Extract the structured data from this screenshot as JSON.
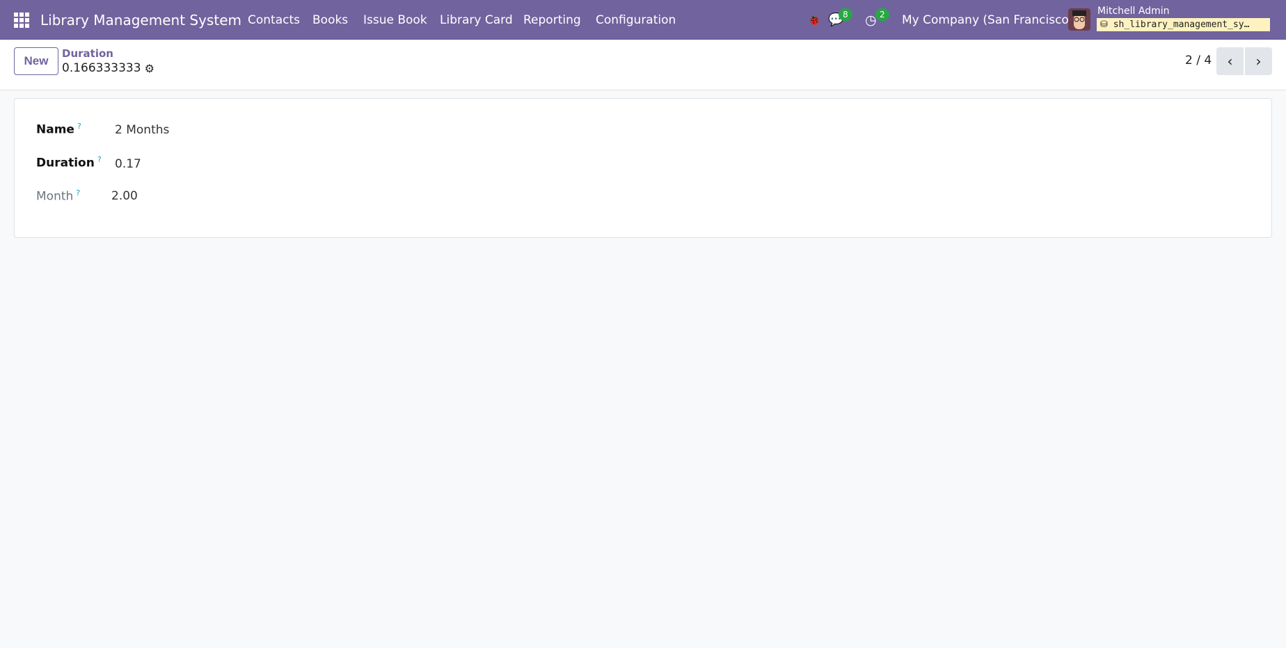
{
  "navbar": {
    "title": "Library Management System",
    "menu": [
      "Contacts",
      "Books",
      "Issue Book",
      "Library Card",
      "Reporting",
      "Configuration"
    ],
    "messages_count": "8",
    "activities_count": "2",
    "company": "My Company (San Francisco)",
    "user": "Mitchell Admin",
    "database": "sh_library_management_sy…"
  },
  "control_panel": {
    "new_label": "New",
    "breadcrumb_parent": "Duration",
    "breadcrumb_current": "0.166333333",
    "pager": "2 / 4"
  },
  "form": {
    "fields": [
      {
        "label": "Name",
        "value": "2 Months"
      },
      {
        "label": "Duration",
        "value": "0.17"
      },
      {
        "label": "Month",
        "value": "2.00"
      }
    ],
    "help_mark": "?"
  },
  "colors": {
    "brand": "#71639e",
    "badge": "#28a745"
  }
}
